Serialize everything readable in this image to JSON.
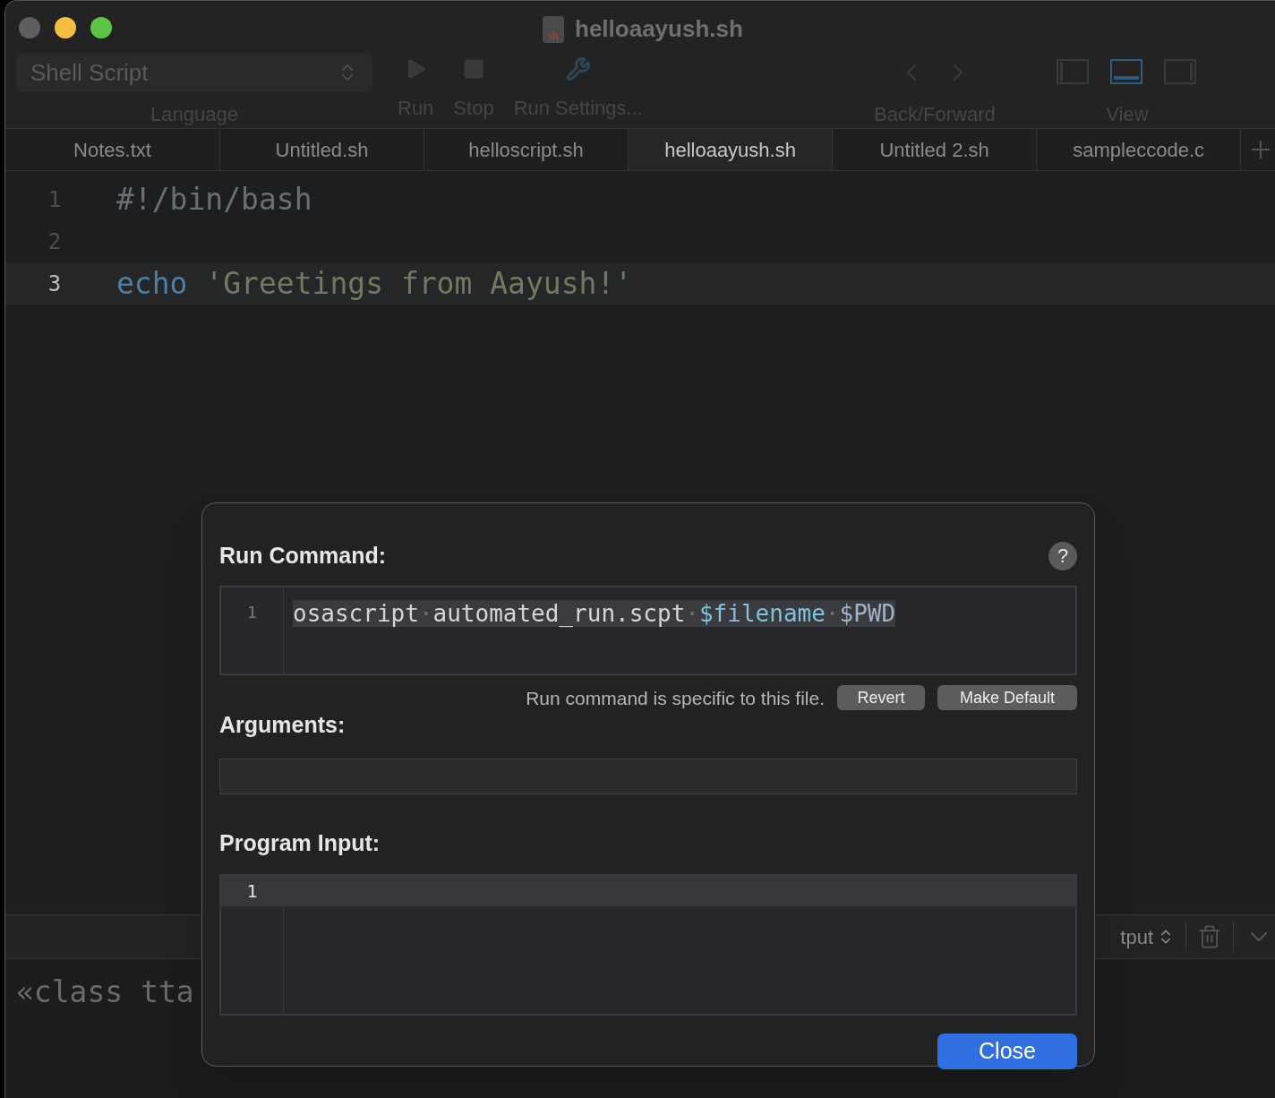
{
  "window": {
    "title": "helloaayush.sh",
    "file_badge": "sh"
  },
  "toolbar": {
    "language": {
      "value": "Shell Script",
      "label": "Language"
    },
    "items": [
      {
        "kind": "run",
        "label": "Run"
      },
      {
        "kind": "stop",
        "label": "Stop"
      },
      {
        "kind": "settings",
        "label": "Run Settings..."
      }
    ],
    "navigation": {
      "label": "Back/Forward"
    },
    "view": {
      "label": "View",
      "layouts": [
        {
          "kind": "left",
          "selected": false
        },
        {
          "kind": "bottom",
          "selected": true
        },
        {
          "kind": "right",
          "selected": false
        }
      ]
    }
  },
  "tabs": [
    {
      "label": "Notes.txt",
      "selected": false
    },
    {
      "label": "Untitled.sh",
      "selected": false
    },
    {
      "label": "helloscript.sh",
      "selected": false
    },
    {
      "label": "helloaayush.sh",
      "selected": true
    },
    {
      "label": "Untitled 2.sh",
      "selected": false
    },
    {
      "label": "sampleccode.c",
      "selected": false
    }
  ],
  "editor": {
    "lines": [
      {
        "number": "1",
        "current": false,
        "tokens": [
          {
            "kind": "comment",
            "text": "#!/bin/bash"
          }
        ]
      },
      {
        "number": "2",
        "current": false
      },
      {
        "number": "3",
        "current": true,
        "tokens": [
          {
            "kind": "keyword",
            "text": "echo"
          },
          {
            "kind": "string",
            "text": "'Greetings from Aayush!'"
          }
        ]
      }
    ]
  },
  "output_bar": {
    "selector": "tput"
  },
  "output": {
    "text": "«class tta"
  },
  "dialog": {
    "run_command_label": "Run Command:",
    "help": "?",
    "command": {
      "number": "1",
      "tokens": [
        {
          "kind": "plain",
          "text": "osascript"
        },
        {
          "kind": "space",
          "text": "·"
        },
        {
          "kind": "plain",
          "text": "automated_run.scpt"
        },
        {
          "kind": "space",
          "text": "·"
        },
        {
          "kind": "var",
          "text": "$filename"
        },
        {
          "kind": "space",
          "text": "·"
        },
        {
          "kind": "env",
          "text": "$PWD"
        }
      ]
    },
    "note": "Run command is specific to this file.",
    "buttons": [
      "Revert",
      "Make Default"
    ],
    "arguments_label": "Arguments:",
    "program_input_label": "Program Input:",
    "program_input": {
      "number": "1"
    },
    "close": "Close"
  }
}
